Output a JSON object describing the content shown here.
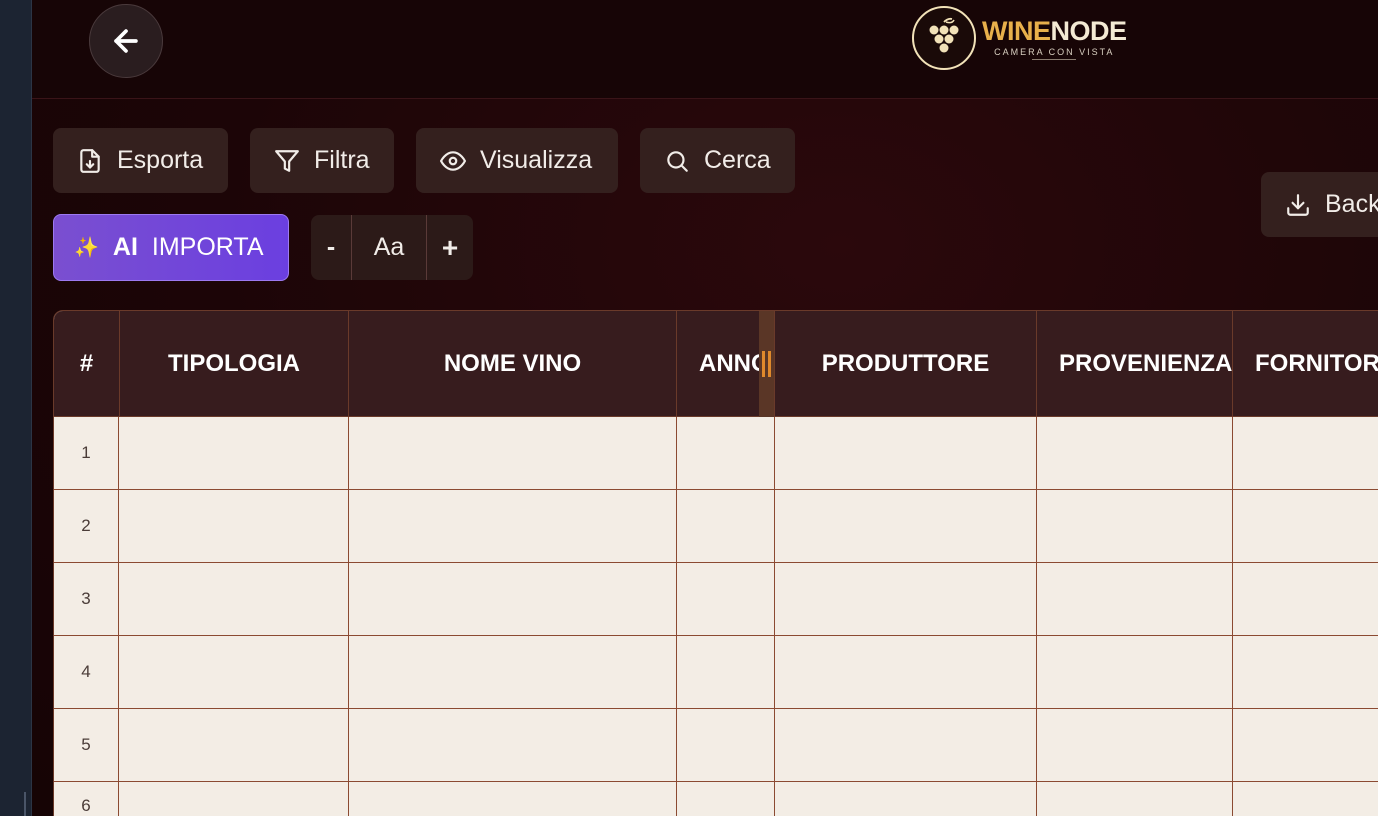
{
  "app": {
    "logo": {
      "brand_part1": "WINE",
      "brand_part2": "NODE",
      "tagline": "CAMERA CON VISTA"
    }
  },
  "toolbar": {
    "esporta_label": "Esporta",
    "filtra_label": "Filtra",
    "visualizza_label": "Visualizza",
    "cerca_label": "Cerca",
    "backup_label": "Back",
    "ai_label": "AI",
    "importa_label": "IMPORTA",
    "font_minus": "-",
    "font_aa": "Aa",
    "font_plus": "+"
  },
  "table": {
    "columns": [
      "#",
      "TIPOLOGIA",
      "NOME VINO",
      "ANNO",
      "PRODUTTORE",
      "PROVENIENZA",
      "FORNITORE"
    ],
    "rows": [
      "1",
      "2",
      "3",
      "4",
      "5",
      "6"
    ]
  },
  "colors": {
    "background": "#1c0507",
    "header": "#371c1e",
    "cell": "#f3ede5",
    "ai_button": "#6b3fe0",
    "accent": "#e8b04b"
  }
}
